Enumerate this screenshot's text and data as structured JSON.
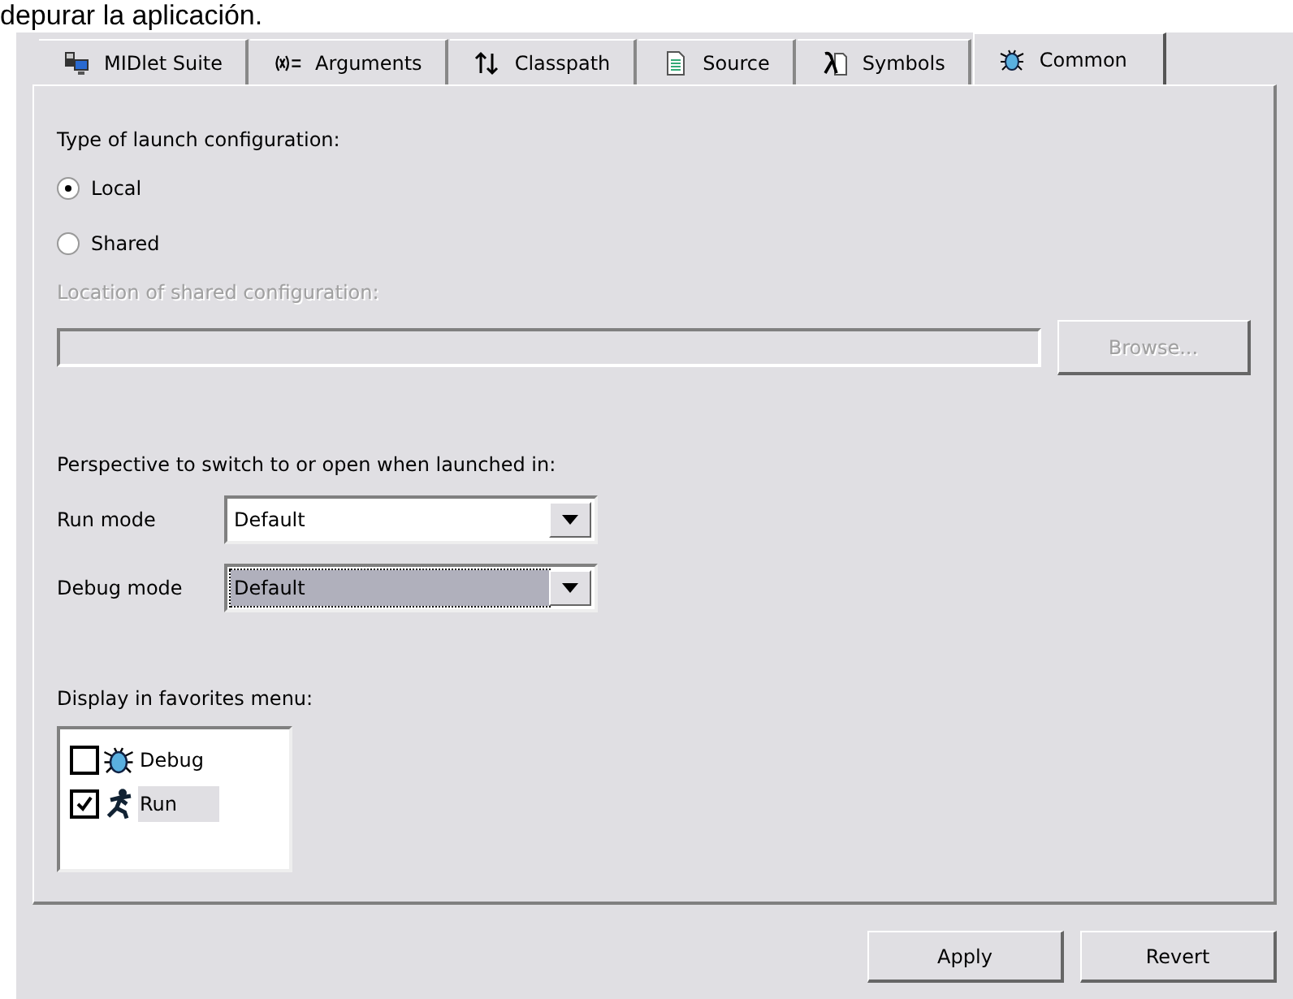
{
  "caption": "depurar la aplicación.",
  "tabs": [
    {
      "label": "MIDlet Suite",
      "kind": "devices",
      "selected": false
    },
    {
      "label": "Arguments",
      "kind": "args",
      "selected": false
    },
    {
      "label": "Classpath",
      "kind": "arrows",
      "selected": false
    },
    {
      "label": "Source",
      "kind": "page",
      "selected": false
    },
    {
      "label": "Symbols",
      "kind": "lambda",
      "selected": false
    },
    {
      "label": "Common",
      "kind": "bug",
      "selected": true
    }
  ],
  "launch_type": {
    "label": "Type of launch configuration:",
    "options": [
      {
        "label": "Local",
        "selected": true
      },
      {
        "label": "Shared",
        "selected": false
      }
    ]
  },
  "shared_location": {
    "label": "Location of shared configuration:",
    "disabled": true,
    "browse": "Browse..."
  },
  "perspective": {
    "label": "Perspective to switch to or open when launched in:",
    "modes": [
      {
        "label": "Run mode",
        "value": "Default",
        "focused": false
      },
      {
        "label": "Debug mode",
        "value": "Default",
        "focused": true
      }
    ]
  },
  "favorites": {
    "label": "Display in favorites menu:",
    "items": [
      {
        "label": "Debug",
        "kind": "bug",
        "checked": false,
        "selected": false
      },
      {
        "label": "Run",
        "kind": "runner",
        "checked": true,
        "selected": true
      }
    ]
  },
  "buttons": [
    "Apply",
    "Revert"
  ]
}
